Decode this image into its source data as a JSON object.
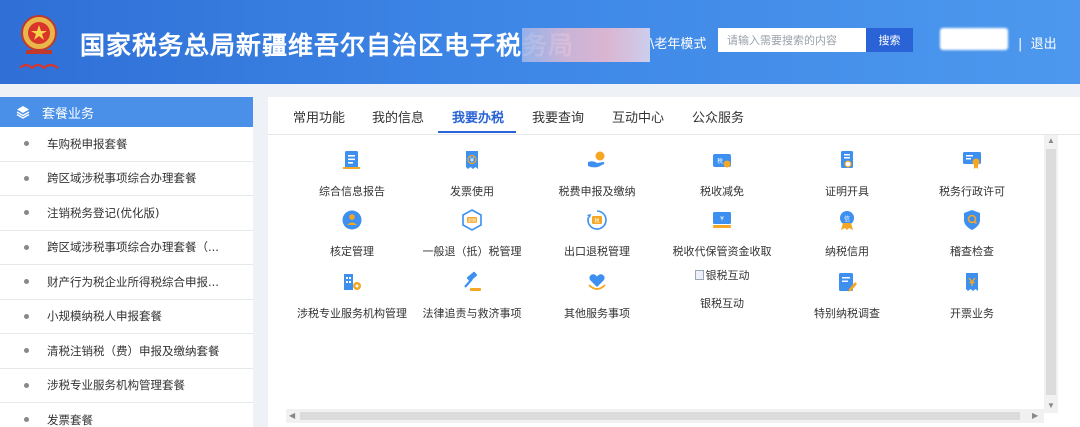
{
  "header": {
    "title": "国家税务总局新疆维吾尔自治区电子税务局",
    "emblem_caption": "中国税务",
    "elder_mode": "\\老年模式",
    "search_placeholder": "请输入需要搜索的内容",
    "search_button": "搜索",
    "separator": "|",
    "logout": "退出"
  },
  "sidebar": {
    "title": "套餐业务",
    "items": [
      {
        "label": "车购税申报套餐"
      },
      {
        "label": "跨区域涉税事项综合办理套餐"
      },
      {
        "label": "注销税务登记(优化版)"
      },
      {
        "label": "跨区域涉税事项综合办理套餐（..."
      },
      {
        "label": "财产行为税企业所得税综合申报..."
      },
      {
        "label": "小规模纳税人申报套餐"
      },
      {
        "label": "清税注销税（费）申报及缴纳套餐"
      },
      {
        "label": "涉税专业服务机构管理套餐"
      },
      {
        "label": "发票套餐"
      }
    ]
  },
  "tabs": [
    {
      "label": "常用功能"
    },
    {
      "label": "我的信息"
    },
    {
      "label": "我要办税",
      "active": true
    },
    {
      "label": "我要查询"
    },
    {
      "label": "互动中心"
    },
    {
      "label": "公众服务"
    }
  ],
  "services": [
    {
      "label": "综合信息报告",
      "icon": "report-icon"
    },
    {
      "label": "发票使用",
      "icon": "invoice-icon"
    },
    {
      "label": "税费申报及缴纳",
      "icon": "tax-payment-icon"
    },
    {
      "label": "税收减免",
      "icon": "tax-relief-icon"
    },
    {
      "label": "证明开具",
      "icon": "certificate-icon"
    },
    {
      "label": "税务行政许可",
      "icon": "license-icon"
    },
    {
      "label": "核定管理",
      "icon": "assessment-icon"
    },
    {
      "label": "一般退（抵）税管理",
      "icon": "refund-icon"
    },
    {
      "label": "出口退税管理",
      "icon": "export-refund-icon"
    },
    {
      "label": "税收代保管资金收取",
      "icon": "custody-funds-icon"
    },
    {
      "label": "纳税信用",
      "icon": "credit-icon"
    },
    {
      "label": "稽查检查",
      "icon": "inspection-icon"
    },
    {
      "label": "涉税专业服务机构管理",
      "icon": "agency-icon"
    },
    {
      "label": "法律追责与救济事项",
      "icon": "gavel-icon"
    },
    {
      "label": "其他服务事项",
      "icon": "heart-icon"
    },
    {
      "label": "银税互动",
      "icon": "bank-tax-icon",
      "broken_image_alt": "银税互动"
    },
    {
      "label": "特别纳税调查",
      "icon": "investigation-icon"
    },
    {
      "label": "开票业务",
      "icon": "issue-invoice-icon"
    }
  ],
  "colors": {
    "header_gradient_start": "#2f6fd6",
    "sidebar_header": "#4a90e8",
    "accent": "#2a63d6",
    "icon_blue": "#3d8ff0",
    "icon_orange": "#f5a623"
  }
}
